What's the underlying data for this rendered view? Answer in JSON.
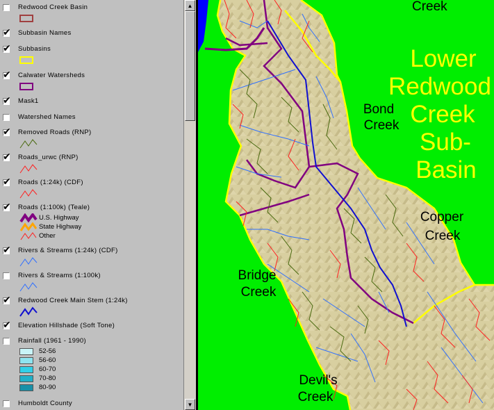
{
  "legend": {
    "layers": [
      {
        "label": "Redwood Creek Basin",
        "checked": false
      },
      {
        "label": "Subbasin Names",
        "checked": true
      },
      {
        "label": "Subbasins",
        "checked": true
      },
      {
        "label": "Calwater Watersheds",
        "checked": true
      },
      {
        "label": "Mask1",
        "checked": true
      },
      {
        "label": "Watershed Names",
        "checked": false
      },
      {
        "label": "Removed Roads (RNP)",
        "checked": true
      },
      {
        "label": "Roads_urwc (RNP)",
        "checked": true
      },
      {
        "label": "Roads (1:24k) (CDF)",
        "checked": true
      },
      {
        "label": "Roads (1:100k) (Teale)",
        "checked": true
      },
      {
        "label": "Rivers & Streams (1:24k) (CDF)",
        "checked": true
      },
      {
        "label": "Rivers & Streams (1:100k)",
        "checked": false
      },
      {
        "label": "Redwood Creek Main Stem (1:24k)",
        "checked": true
      },
      {
        "label": "Elevation Hillshade (Soft Tone)",
        "checked": true
      },
      {
        "label": "Rainfall (1961 - 1990)",
        "checked": false
      },
      {
        "label": "Humboldt County",
        "checked": false
      }
    ],
    "road_classes": [
      "U.S. Highway",
      "State Highway",
      "Other"
    ],
    "rainfall_classes": [
      "52-56",
      "56-60",
      "60-70",
      "70-80",
      "80-90"
    ]
  },
  "map": {
    "labels": {
      "creek_top": "Creek",
      "lower1": "Lower",
      "lower2": "Redwood",
      "lower3": "Creek",
      "lower4": "Sub-",
      "lower5": "Basin",
      "bond1": "Bond",
      "bond2": "Creek",
      "copper1": "Copper",
      "copper2": "Creek",
      "bridge1": "Bridge",
      "bridge2": "Creek",
      "devils1": "Devil's",
      "devils2": "Creek"
    }
  },
  "colors": {
    "mask_green": "#00ee00",
    "terrain": "#d8cfa0",
    "subbasin_yellow": "#ffff00",
    "watershed_purple": "#800080",
    "road_red": "#ff2020",
    "removed_road": "#4a6a10",
    "stream_blue": "#3070ff",
    "main_stem": "#1010d0",
    "ocean": "#0000ff"
  }
}
